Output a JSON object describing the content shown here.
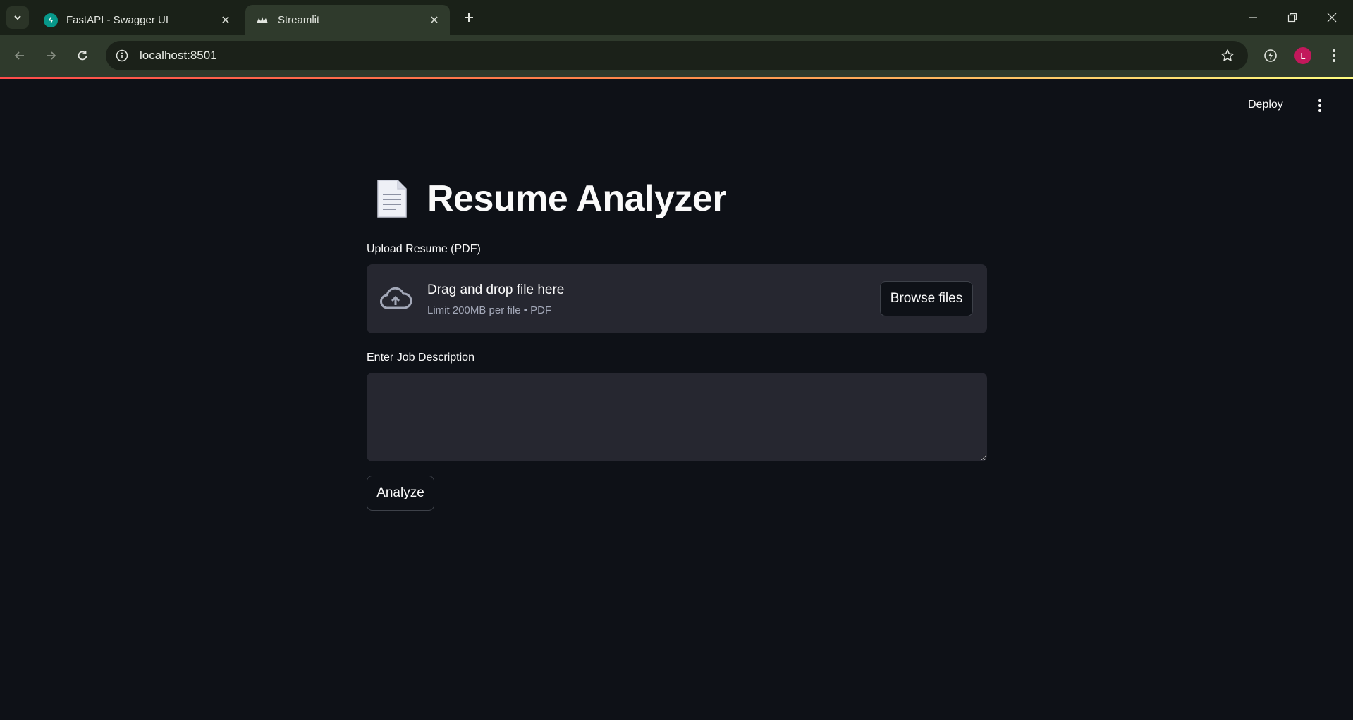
{
  "browser": {
    "tabs": [
      {
        "title": "FastAPI - Swagger UI",
        "favicon": "fastapi-icon",
        "active": false
      },
      {
        "title": "Streamlit",
        "favicon": "streamlit-icon",
        "active": true
      }
    ],
    "url": "localhost:8501",
    "profile_initial": "L",
    "colors": {
      "tabbar": "#1a2118",
      "toolbar": "#2f3a2c",
      "profile": "#c2185b"
    }
  },
  "app": {
    "header": {
      "deploy_label": "Deploy"
    },
    "title_icon": "document-icon",
    "title": "Resume Analyzer",
    "upload": {
      "label": "Upload Resume (PDF)",
      "dropzone_title": "Drag and drop file here",
      "dropzone_subtitle": "Limit 200MB per file • PDF",
      "browse_label": "Browse files"
    },
    "job_description": {
      "label": "Enter Job Description",
      "value": ""
    },
    "analyze_label": "Analyze",
    "colors": {
      "background": "#0e1117",
      "widget": "#262730",
      "accent_start": "#ff4b4b",
      "accent_end": "#fffd80"
    }
  }
}
